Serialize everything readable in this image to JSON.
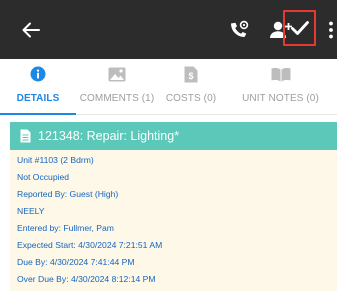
{
  "colors": {
    "topbar_bg": "#2c2c2c",
    "accent_blue": "#1e88e5",
    "banner_bg": "#5bc8b9",
    "detail_bg": "#fdf8e7",
    "highlight_border": "#e53935"
  },
  "toolbar": {
    "back_icon": "arrow-left",
    "call_icon": "phone-settings",
    "add_user_icon": "person-add",
    "save_icon": "check",
    "more_icon": "more-vertical"
  },
  "tabs": [
    {
      "label": "DETAILS",
      "icon": "info-circle",
      "active": true
    },
    {
      "label": "COMMENTS (1)",
      "icon": "image",
      "active": false
    },
    {
      "label": "COSTS (0)",
      "icon": "dollar-document",
      "active": false
    },
    {
      "label": "UNIT NOTES (0)",
      "icon": "open-book",
      "active": false
    }
  ],
  "work_order": {
    "title": "121348: Repair: Lighting*",
    "lines": [
      "Unit #1103 (2 Bdrm)",
      "Not Occupied",
      "Reported By: Guest  (High)",
      "NEELY",
      "Entered by: Fullmer, Pam",
      "Expected Start: 4/30/2024 7:21:51 AM",
      "Due By: 4/30/2024 7:41:44 PM",
      "Over Due By: 4/30/2024 8:12:14 PM"
    ]
  }
}
